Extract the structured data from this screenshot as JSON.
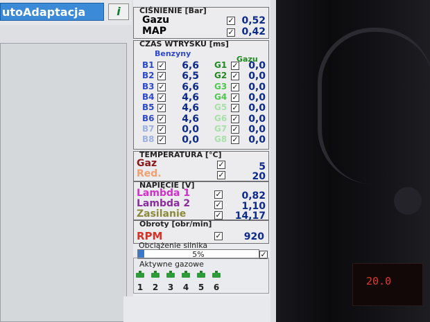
{
  "app": {
    "title": "utoAdaptacja",
    "help_glyph": "i"
  },
  "pressure": {
    "title": "CIŚNIENIE [Bar]",
    "rows": [
      {
        "label": "Gazu",
        "value": "0,52",
        "checked": true,
        "color": "#2e4a16"
      },
      {
        "label": "MAP",
        "value": "0,42",
        "checked": true,
        "color": "#2e4a16"
      }
    ]
  },
  "injection": {
    "title": "CZAS WTRYSKU [ms]",
    "col_petrol": "Benzyny",
    "col_gas": "Gazu",
    "petrol": [
      {
        "label": "B1",
        "value": "6,6"
      },
      {
        "label": "B2",
        "value": "6,5"
      },
      {
        "label": "B3",
        "value": "6,6"
      },
      {
        "label": "B4",
        "value": "4,6"
      },
      {
        "label": "B5",
        "value": "4,6"
      },
      {
        "label": "B6",
        "value": "4,6"
      },
      {
        "label": "B7",
        "value": "0,0"
      },
      {
        "label": "B8",
        "value": "0,0"
      }
    ],
    "gas": [
      {
        "label": "G1",
        "value": "0,0"
      },
      {
        "label": "G2",
        "value": "0,0"
      },
      {
        "label": "G3",
        "value": "0,0"
      },
      {
        "label": "G4",
        "value": "0,0"
      },
      {
        "label": "G5",
        "value": "0,0"
      },
      {
        "label": "G6",
        "value": "0,0"
      },
      {
        "label": "G7",
        "value": "0,0"
      },
      {
        "label": "G8",
        "value": "0,0"
      }
    ],
    "petrol_color": "#2e49c8",
    "gas_color": "#1f8a1f"
  },
  "temperature": {
    "title": "TEMPERATURA [°C]",
    "rows": [
      {
        "label": "Gaz",
        "value": "5",
        "color": "#8a1818"
      },
      {
        "label": "Red.",
        "value": "20",
        "color": "#f0a070"
      }
    ]
  },
  "voltage": {
    "title": "NAPIĘCIE [V]",
    "rows": [
      {
        "label": "Lambda 1",
        "value": "0,82",
        "color": "#d12fcc"
      },
      {
        "label": "Lambda 2",
        "value": "1,10",
        "color": "#8a2c9e"
      },
      {
        "label": "Zasilanie",
        "value": "14,17",
        "color": "#8a8a3a"
      }
    ]
  },
  "rpm": {
    "title": "Obroty [obr/min]",
    "label": "RPM",
    "value": "920",
    "color": "#d63228"
  },
  "load": {
    "title": "Obciążenie silnika",
    "percent_text": "5%",
    "fraction": 0.05
  },
  "active_gas": {
    "title": "Aktywne gazowe",
    "cylinders": [
      "1",
      "2",
      "3",
      "4",
      "5",
      "6"
    ]
  },
  "dashboard": {
    "clock": "20.0"
  }
}
